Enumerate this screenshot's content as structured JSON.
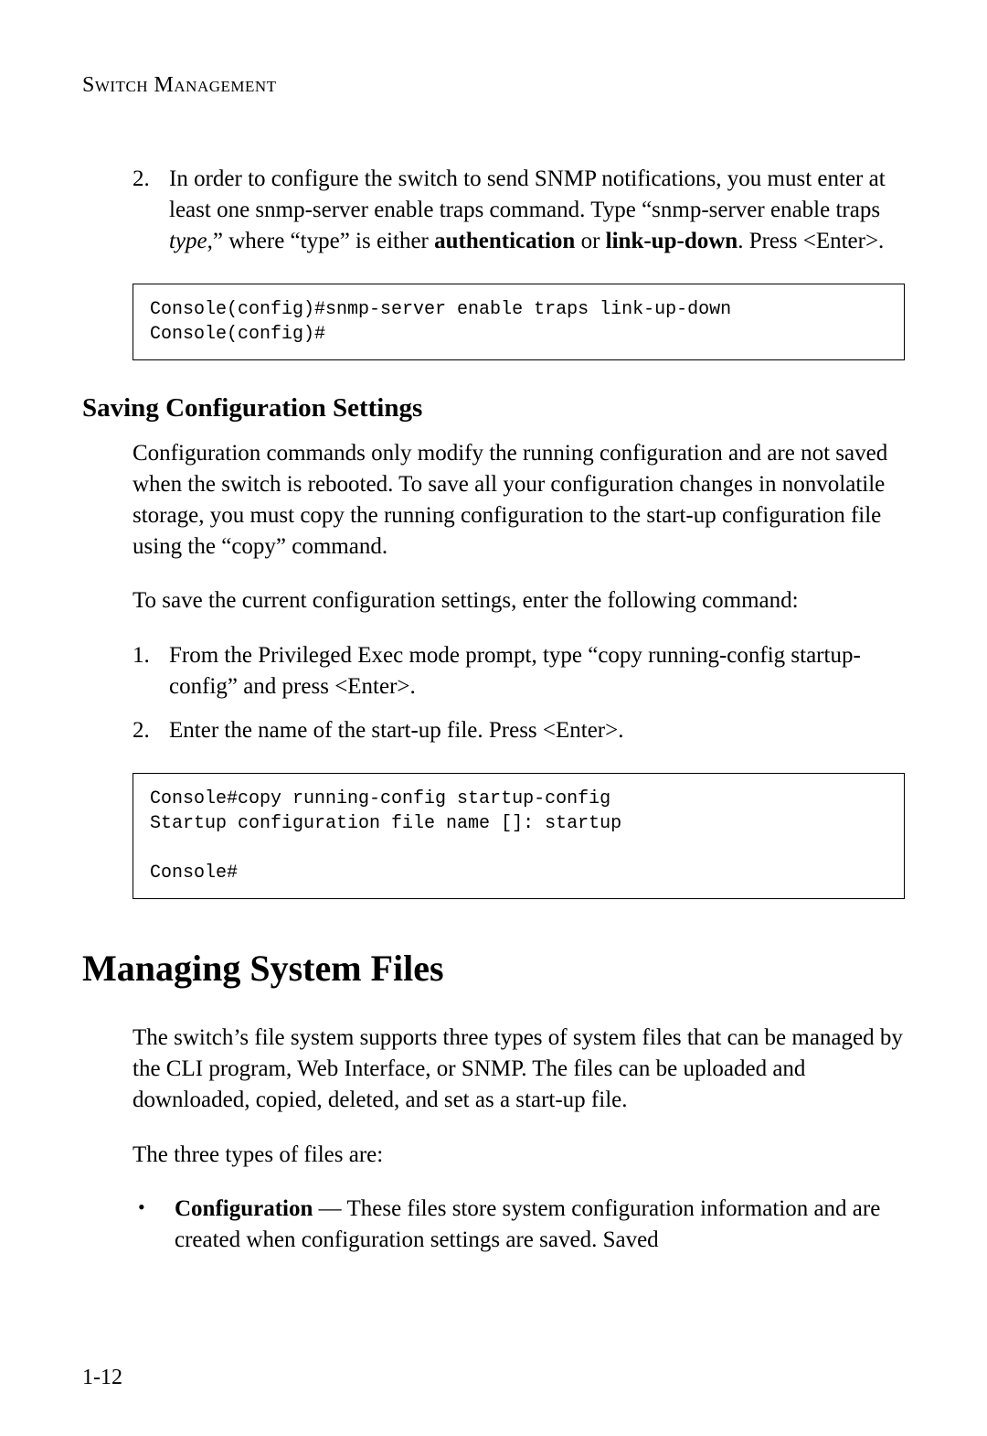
{
  "running_head": "Switch Management",
  "list1": {
    "num": "2.",
    "t1": "In order to configure the switch to send SNMP notifications, you must enter at least one snmp-server enable traps command. Type “snmp-server enable traps ",
    "t_italic": "type",
    "t2": ",” where “type” is either ",
    "t_bold1": "authentication",
    "t3": " or ",
    "t_bold2": "link-up-down",
    "t4": ". Press <Enter>."
  },
  "code1": "Console(config)#snmp-server enable traps link-up-down\nConsole(config)#",
  "heading_saving": "Saving Configuration Settings",
  "para_saving1": "Configuration commands only modify the running configuration and are not saved when the switch is rebooted. To save all your configuration changes in nonvolatile storage, you must copy the running configuration to the start-up configuration file using the “copy” command.",
  "para_saving2": "To save the current configuration settings, enter the following command:",
  "list2": [
    {
      "num": "1.",
      "text": "From the Privileged Exec mode prompt, type “copy running-config startup-config” and press <Enter>."
    },
    {
      "num": "2.",
      "text": "Enter the name of the start-up file. Press <Enter>."
    }
  ],
  "code2": "Console#copy running-config startup-config\nStartup configuration file name []: startup\n\nConsole#",
  "heading_managing": "Managing System Files",
  "para_managing1": "The switch’s file system supports three types of system files that can be managed by the CLI program, Web Interface, or SNMP. The files can be uploaded and downloaded, copied, deleted, and set as a start-up file.",
  "para_managing2": "The three types of files are:",
  "bullet1": {
    "lead_bold": "Configuration",
    "dash": " — ",
    "rest": "These files store system configuration information and are created when configuration settings are saved. Saved"
  },
  "page_number": "1-12"
}
